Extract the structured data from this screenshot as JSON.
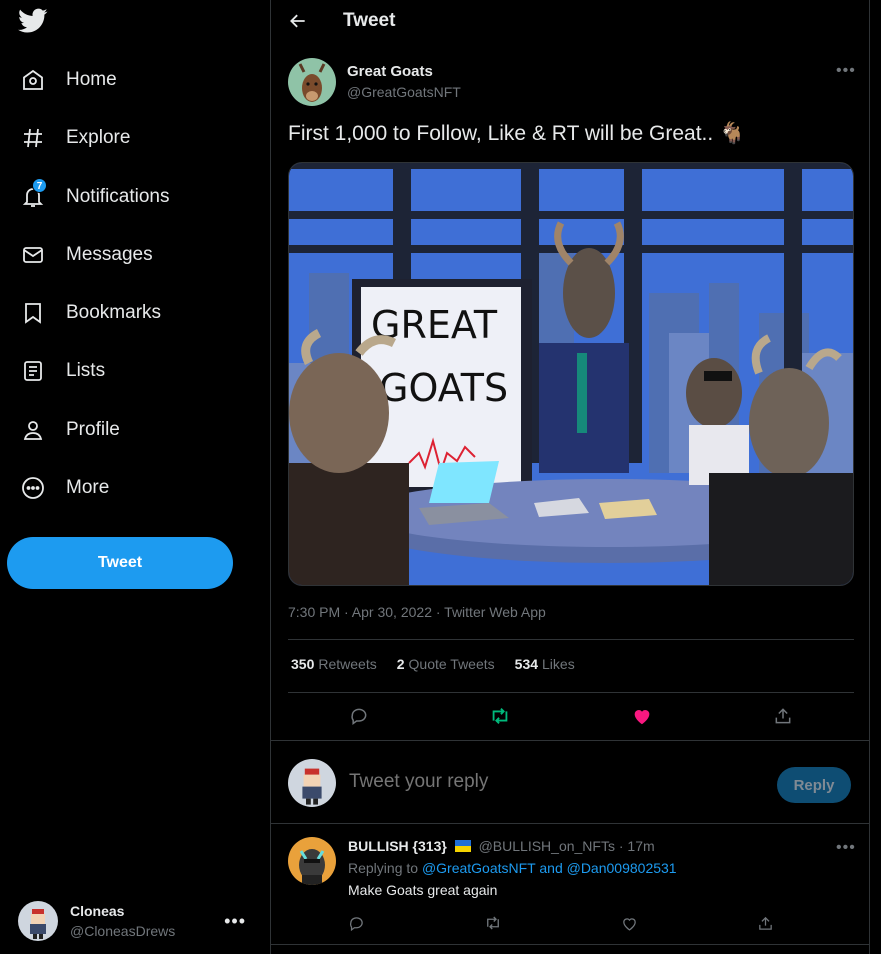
{
  "sidebar": {
    "logo": "twitter-bird-icon",
    "items": [
      {
        "label": "Home",
        "icon": "home-icon"
      },
      {
        "label": "Explore",
        "icon": "hashtag-icon"
      },
      {
        "label": "Notifications",
        "icon": "bell-icon",
        "badge": "7"
      },
      {
        "label": "Messages",
        "icon": "envelope-icon"
      },
      {
        "label": "Bookmarks",
        "icon": "bookmark-icon"
      },
      {
        "label": "Lists",
        "icon": "list-icon"
      },
      {
        "label": "Profile",
        "icon": "person-icon"
      },
      {
        "label": "More",
        "icon": "more-circle-icon"
      }
    ],
    "tweet_button": "Tweet",
    "account": {
      "name": "Cloneas",
      "handle": "@CloneasDrews"
    }
  },
  "header": {
    "title": "Tweet"
  },
  "tweet": {
    "author_name": "Great Goats",
    "author_handle": "@GreatGoatsNFT",
    "text": "First 1,000 to Follow, Like & RT will be Great.. 🐐",
    "image_sign_text_1": "GREAT",
    "image_sign_text_2": "GOATS",
    "timestamp": "7:30 PM · Apr 30, 2022 · Twitter Web App",
    "retweets_count": "350",
    "retweets_label": "Retweets",
    "quotes_count": "2",
    "quotes_label": "Quote Tweets",
    "likes_count": "534",
    "likes_label": "Likes"
  },
  "reply_box": {
    "placeholder": "Tweet your reply",
    "button": "Reply"
  },
  "reply": {
    "name": "BULLISH {313}",
    "handle_time": "@BULLISH_on_NFTs · 17m",
    "replying_prefix": "Replying to",
    "replying_to": "@GreatGoatsNFT and @Dan009802531",
    "text": "Make Goats great again"
  },
  "colors": {
    "accent": "#1d9bf0",
    "retweeted": "#00ba7c",
    "liked": "#f91880",
    "background": "#000000"
  }
}
